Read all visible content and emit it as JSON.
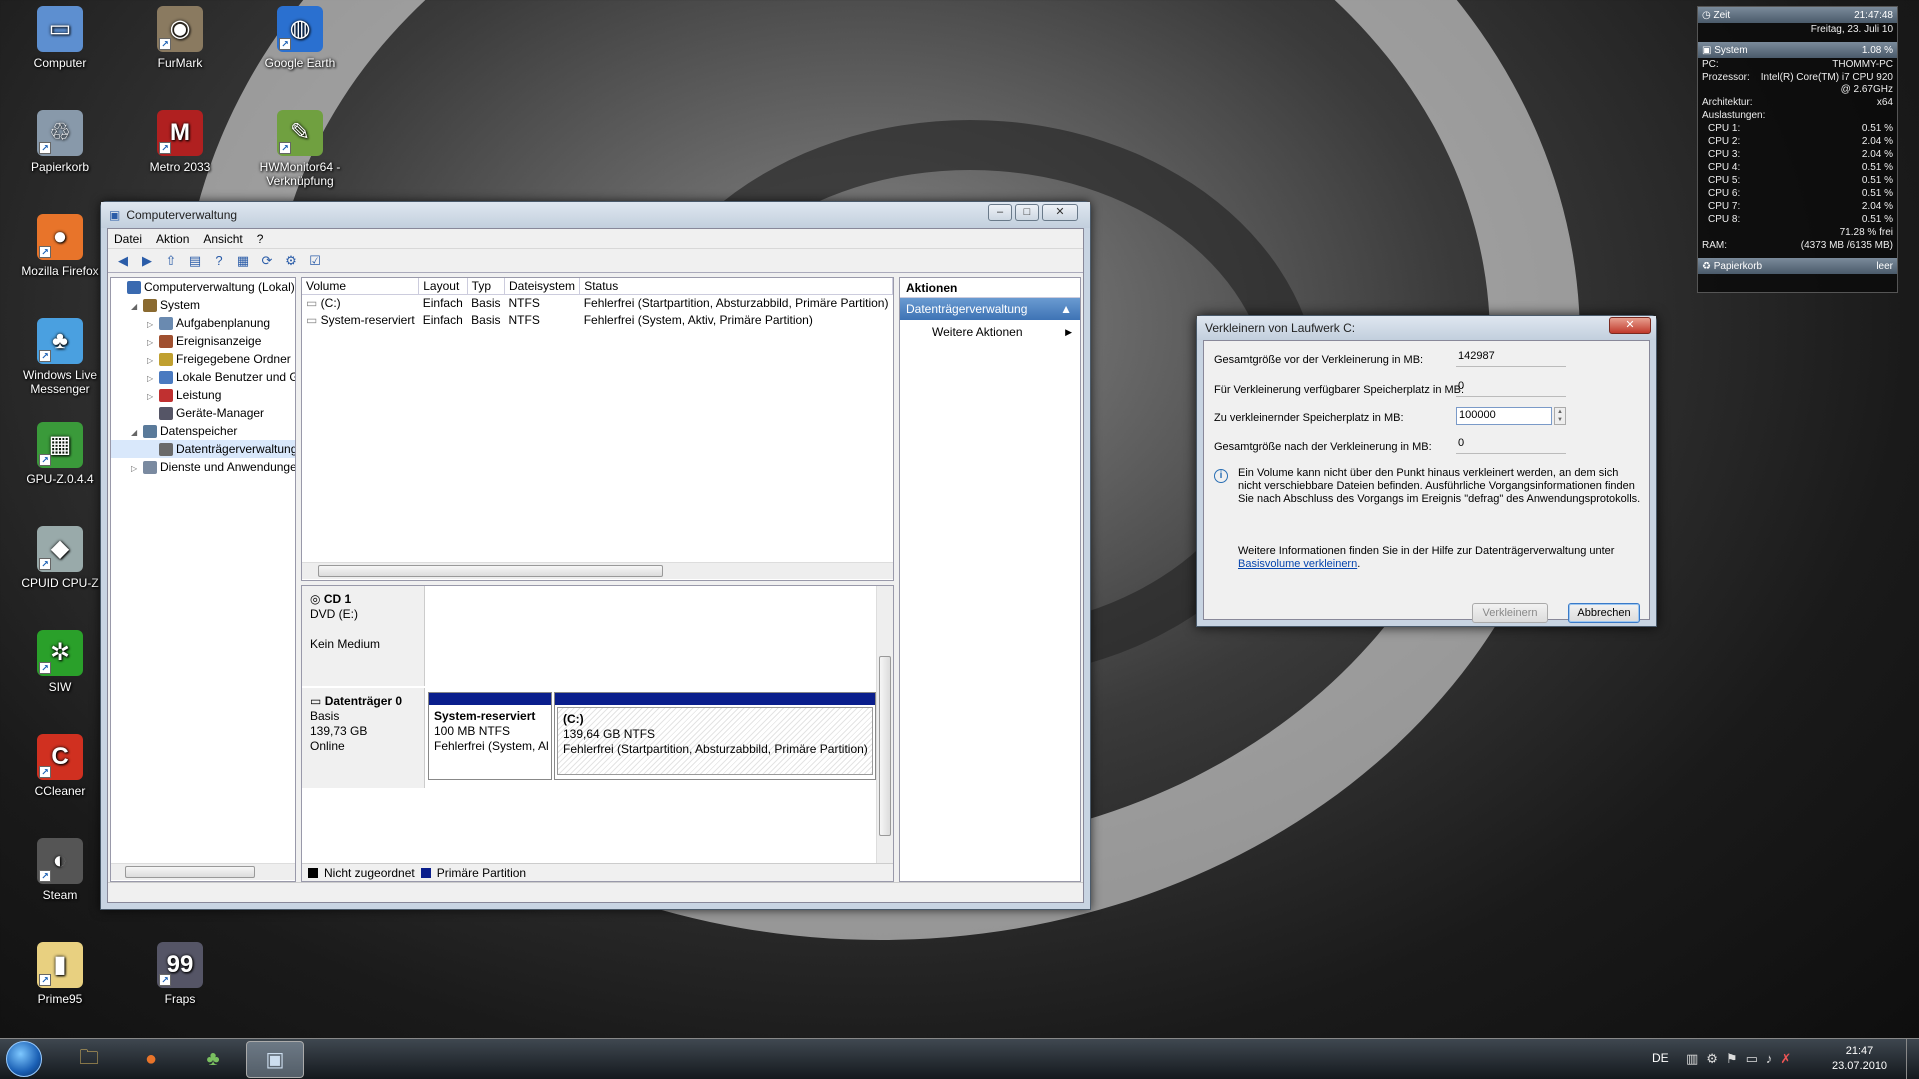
{
  "desktop": {
    "icons": [
      {
        "label": "Computer"
      },
      {
        "label": "FurMark"
      },
      {
        "label": "Google Earth"
      },
      {
        "label": "Papierkorb"
      },
      {
        "label": "Metro 2033"
      },
      {
        "label": "HWMonitor64 - Verknüpfung"
      },
      {
        "label": "Mozilla Firefox"
      },
      {
        "label": "Windows Live Messenger"
      },
      {
        "label": "GPU-Z.0.4.4"
      },
      {
        "label": "CPUID CPU-Z"
      },
      {
        "label": "SIW"
      },
      {
        "label": "CCleaner"
      },
      {
        "label": "Steam"
      },
      {
        "label": "Prime95"
      },
      {
        "label": "Fraps"
      }
    ]
  },
  "window": {
    "title": "Computerverwaltung",
    "menu": [
      "Datei",
      "Aktion",
      "Ansicht",
      "?"
    ],
    "tree": [
      {
        "label": "Computerverwaltung (Lokal)",
        "level": 0
      },
      {
        "label": "System",
        "level": 1
      },
      {
        "label": "Aufgabenplanung",
        "level": 2
      },
      {
        "label": "Ereignisanzeige",
        "level": 2
      },
      {
        "label": "Freigegebene Ordner",
        "level": 2
      },
      {
        "label": "Lokale Benutzer und Gr",
        "level": 2
      },
      {
        "label": "Leistung",
        "level": 2
      },
      {
        "label": "Geräte-Manager",
        "level": 2
      },
      {
        "label": "Datenspeicher",
        "level": 1
      },
      {
        "label": "Datenträgerverwaltung",
        "level": 2
      },
      {
        "label": "Dienste und Anwendungen",
        "level": 1
      }
    ],
    "volume_table": {
      "headers": [
        "Volume",
        "Layout",
        "Typ",
        "Dateisystem",
        "Status"
      ],
      "rows": [
        [
          "(C:)",
          "Einfach",
          "Basis",
          "NTFS",
          "Fehlerfrei (Startpartition, Absturzabbild, Primäre Partition)"
        ],
        [
          "System-reserviert",
          "Einfach",
          "Basis",
          "NTFS",
          "Fehlerfrei (System, Aktiv, Primäre Partition)"
        ]
      ]
    },
    "disks": {
      "cd": {
        "name": "CD 1",
        "type": "DVD (E:)",
        "status": "Kein Medium"
      },
      "disk0": {
        "name": "Datenträger 0",
        "type": "Basis",
        "size": "139,73 GB",
        "status": "Online",
        "p1": {
          "name": "System-reserviert",
          "size": "100 MB NTFS",
          "status": "Fehlerfrei (System, Al"
        },
        "p2": {
          "name": "(C:)",
          "size": "139,64 GB NTFS",
          "status": "Fehlerfrei (Startpartition, Absturzabbild, Primäre Partition)"
        }
      }
    },
    "legend": {
      "unallocated": "Nicht zugeordnet",
      "primary": "Primäre Partition"
    },
    "actions": {
      "header": "Aktionen",
      "section": "Datenträgerverwaltung",
      "more": "Weitere Aktionen"
    }
  },
  "dialog": {
    "title": "Verkleinern von Laufwerk C:",
    "rows": [
      {
        "label": "Gesamtgröße vor der Verkleinerung in MB:",
        "value": "142987"
      },
      {
        "label": "Für Verkleinerung verfügbarer Speicherplatz in MB:",
        "value": "0"
      },
      {
        "label": "Zu verkleinernder Speicherplatz in MB:",
        "value": "100000"
      },
      {
        "label": "Gesamtgröße nach der Verkleinerung in MB:",
        "value": "0"
      }
    ],
    "info": "Ein Volume kann nicht über den Punkt hinaus verkleinert werden, an dem sich nicht verschiebbare Dateien befinden. Ausführliche Vorgangsinformationen finden Sie nach Abschluss des Vorgangs im Ereignis \"defrag\" des Anwendungsprotokolls.",
    "help": "Weitere Informationen finden Sie in der Hilfe zur Datenträgerverwaltung unter",
    "link": "Basisvolume verkleinern",
    "btn_ok": "Verkleinern",
    "btn_cancel": "Abbrechen"
  },
  "gadget": {
    "time": {
      "label": "Zeit",
      "clock": "21:47:48",
      "date": "Freitag, 23. Juli 10"
    },
    "system": {
      "label": "System",
      "usage": "1.08 %",
      "pc_label": "PC:",
      "pc": "THOMMY-PC",
      "cpu_label": "Prozessor:",
      "cpu": "Intel(R) Core(TM) i7 CPU 920",
      "cpu2": "@ 2.67GHz",
      "arch_label": "Architektur:",
      "arch": "x64",
      "load_label": "Auslastungen:",
      "cores": [
        {
          "name": "CPU 1:",
          "val": "0.51 %"
        },
        {
          "name": "CPU 2:",
          "val": "2.04 %"
        },
        {
          "name": "CPU 3:",
          "val": "2.04 %"
        },
        {
          "name": "CPU 4:",
          "val": "0.51 %"
        },
        {
          "name": "CPU 5:",
          "val": "0.51 %"
        },
        {
          "name": "CPU 6:",
          "val": "0.51 %"
        },
        {
          "name": "CPU 7:",
          "val": "2.04 %"
        },
        {
          "name": "CPU 8:",
          "val": "0.51 %"
        }
      ],
      "ram_label": "RAM:",
      "ram_free": "71.28 % frei",
      "ram": "(4373 MB /6135 MB)"
    },
    "bin": {
      "label": "Papierkorb",
      "state": "leer"
    }
  },
  "taskbar": {
    "lang": "DE",
    "time": "21:47",
    "date": "23.07.2010"
  }
}
